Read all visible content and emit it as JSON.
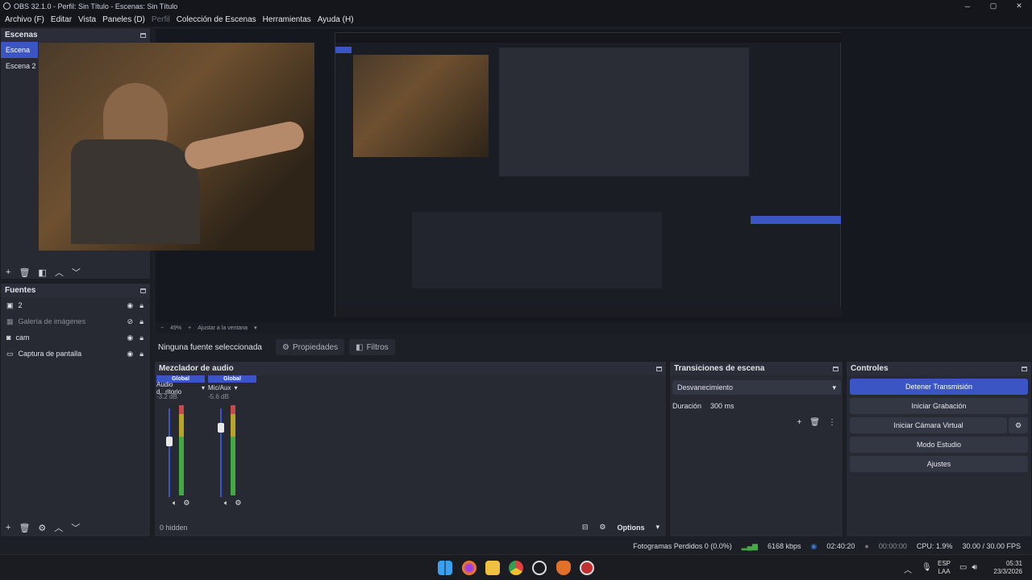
{
  "window": {
    "title": "OBS 32.1.0 - Perfil: Sin Título - Escenas: Sin Título",
    "minimize": "─",
    "maximize": "▢",
    "close": "✕"
  },
  "menu": [
    "Archivo (F)",
    "Editar",
    "Vista",
    "Paneles (D)",
    "Perfil",
    "Colección de Escenas",
    "Herramientas",
    "Ayuda (H)"
  ],
  "scenes": {
    "title": "Escenas",
    "items": [
      "Escena",
      "Escena 2"
    ]
  },
  "sources": {
    "title": "Fuentes",
    "items": [
      "2",
      "Galería de imágenes",
      "cam",
      "Captura de pantalla"
    ]
  },
  "zoom": {
    "minus": "−",
    "percent": "49%",
    "plus": "+",
    "fit": "Ajustar a la ventana"
  },
  "propbar": {
    "no_source": "Ninguna fuente seleccionada",
    "properties": "Propiedades",
    "filters": "Filtros"
  },
  "mixer": {
    "title": "Mezclador de audio",
    "hidden": "0 hidden",
    "options": "Options",
    "channels": [
      {
        "head": "Global",
        "name": "Audio d...ritorio",
        "db": "-3.2 dB",
        "level": 0.63
      },
      {
        "head": "Global",
        "name": "Mic/Aux",
        "db": "-5.6 dB",
        "level": 0.78
      }
    ],
    "scale": [
      "0",
      "-6",
      "-12",
      "-18",
      "-24",
      "-30",
      "-36",
      "-42",
      "-48",
      "-54",
      "-60"
    ]
  },
  "transitions": {
    "title": "Transiciones de escena",
    "selected": "Desvanecimiento",
    "duration_label": "Duración",
    "duration": "300 ms"
  },
  "controls": {
    "title": "Controles",
    "buttons": [
      "Detener Transmisión",
      "Iniciar Grabación",
      "Iniciar Cámara Virtual",
      "Modo Estudio",
      "Ajustes"
    ]
  },
  "status": {
    "dropped": "Fotogramas Perdidos 0 (0.0%)",
    "bitrate": "6168 kbps",
    "stream_time": "02:40:20",
    "rec_time": "00:00:00",
    "cpu": "CPU: 1.9%",
    "fps": "30.00 / 30.00 FPS"
  },
  "taskbar": {
    "lang1": "ESP",
    "lang2": "LAA",
    "time": "05:31",
    "date": "23/3/2026"
  },
  "colors": {
    "accent": "#3b55c4",
    "panel": "#272a33",
    "bg": "#1d1f26"
  }
}
